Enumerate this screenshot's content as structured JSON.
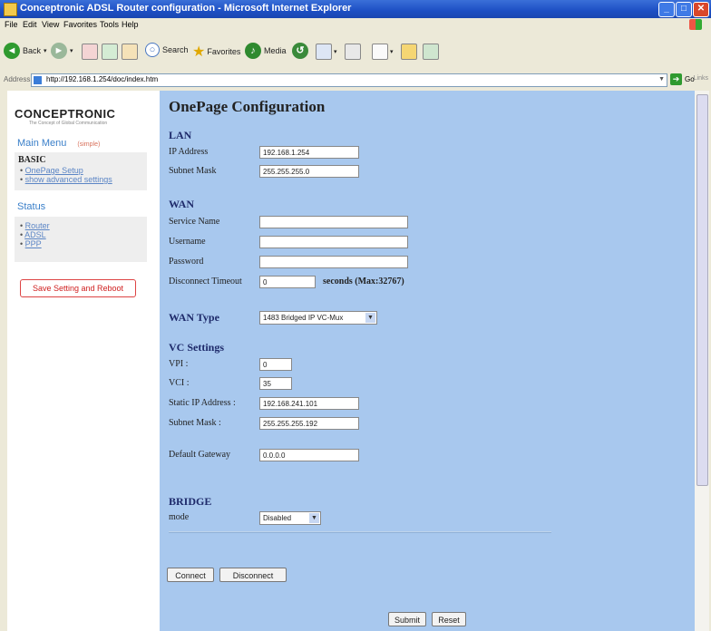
{
  "window": {
    "title": "Conceptronic ADSL Router configuration - Microsoft Internet Explorer"
  },
  "menubar": [
    "File",
    "Edit",
    "View",
    "Favorites",
    "Tools",
    "Help"
  ],
  "toolbar": {
    "back": "Back",
    "search": "Search",
    "favorites": "Favorites",
    "media": "Media"
  },
  "address": {
    "label": "Address",
    "url": "http://192.168.1.254/doc/index.htm",
    "go": "Go",
    "links": "Links"
  },
  "sidebar": {
    "brand": "CONCEPTRONIC",
    "tagline": "The Concept of Global Communication",
    "menu_title": "Main Menu",
    "menu_hint": "(simple)",
    "basic_title": "BASIC",
    "basic_items": [
      "OnePage Setup",
      "show advanced settings"
    ],
    "status_title": "Status",
    "status_items": [
      "Router",
      "ADSL",
      "PPP"
    ],
    "save_button": "Save Setting and Reboot"
  },
  "main": {
    "title": "OnePage Configuration",
    "lan": {
      "title": "LAN",
      "ip_label": "IP Address",
      "ip_value": "192.168.1.254",
      "mask_label": "Subnet Mask",
      "mask_value": "255.255.255.0"
    },
    "wan": {
      "title": "WAN",
      "service_label": "Service Name",
      "username_label": "Username",
      "password_label": "Password",
      "timeout_label": "Disconnect Timeout",
      "timeout_value": "0",
      "timeout_suffix": "seconds (Max:32767)"
    },
    "wan_type": {
      "label": "WAN Type",
      "selected": "1483 Bridged IP VC-Mux"
    },
    "vc": {
      "title": "VC Settings",
      "vpi_label": "VPI :",
      "vpi_value": "0",
      "vci_label": "VCI :",
      "vci_value": "35",
      "static_ip_label": "Static IP Address :",
      "static_ip_value": "192.168.241.101",
      "mask_label": "Subnet Mask :",
      "mask_value": "255.255.255.192",
      "gateway_label": "Default Gateway",
      "gateway_value": "0.0.0.0"
    },
    "bridge": {
      "title": "BRIDGE",
      "mode_label": "mode",
      "mode_value": "Disabled"
    },
    "buttons": {
      "connect": "Connect",
      "disconnect": "Disconnect",
      "submit": "Submit",
      "reset": "Reset"
    }
  },
  "colors": {
    "main_bg": "#a8c8ee",
    "heading": "#1e2a6a",
    "titlebar": "#1d4fc4",
    "link": "#5b85c5",
    "brand_accent": "#c8102e"
  }
}
